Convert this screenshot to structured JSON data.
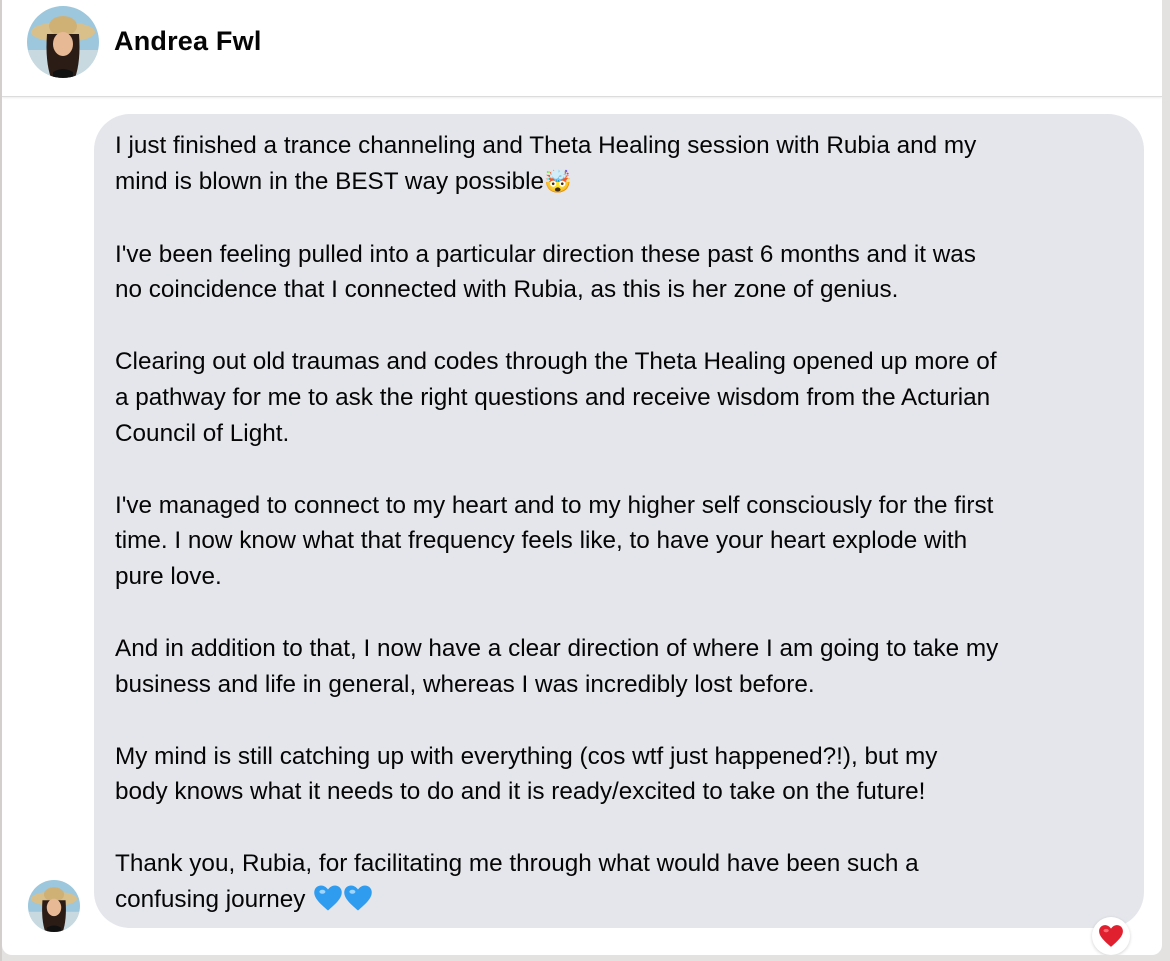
{
  "contact": {
    "name": "Andrea Fwl",
    "avatar_icon": "profile-photo-woman-sun-hat"
  },
  "message": {
    "paragraphs": [
      {
        "lines": [
          "I just finished a trance channeling and Theta Healing session with Rubia and my",
          "mind is blown in the BEST way possible"
        ],
        "trailing_emoji": "🤯"
      },
      {
        "lines": [
          "I've been feeling pulled into a particular direction these past 6 months and it was",
          "no coincidence that I connected with Rubia, as this is her zone of genius."
        ]
      },
      {
        "lines": [
          "Clearing out old traumas and codes through the Theta Healing opened up more of",
          "a pathway for me to ask the right questions and receive wisdom from the Acturian",
          "Council of Light."
        ]
      },
      {
        "lines": [
          "I've managed to connect to my heart and to my higher self consciously for the first",
          "time. I now know what that frequency feels like, to have your heart explode with",
          "pure love."
        ]
      },
      {
        "lines": [
          "And in addition to that, I now have a clear direction of where I am going to take my",
          "business and life in general, whereas I was incredibly lost before."
        ]
      },
      {
        "lines": [
          "My mind is still catching up with everything (cos wtf just happened?!), but my",
          "body knows what it needs to do and it is ready/excited to take on the future!"
        ]
      },
      {
        "lines": [
          "Thank you, Rubia, for facilitating me through what would have been such a",
          "confusing journey"
        ],
        "trailing_icons": [
          "blue-heart-icon",
          "blue-heart-icon"
        ]
      }
    ],
    "bubble_color": "#e4e6eb",
    "reaction": {
      "icon": "red-heart-icon",
      "color": "#e0202e"
    }
  }
}
